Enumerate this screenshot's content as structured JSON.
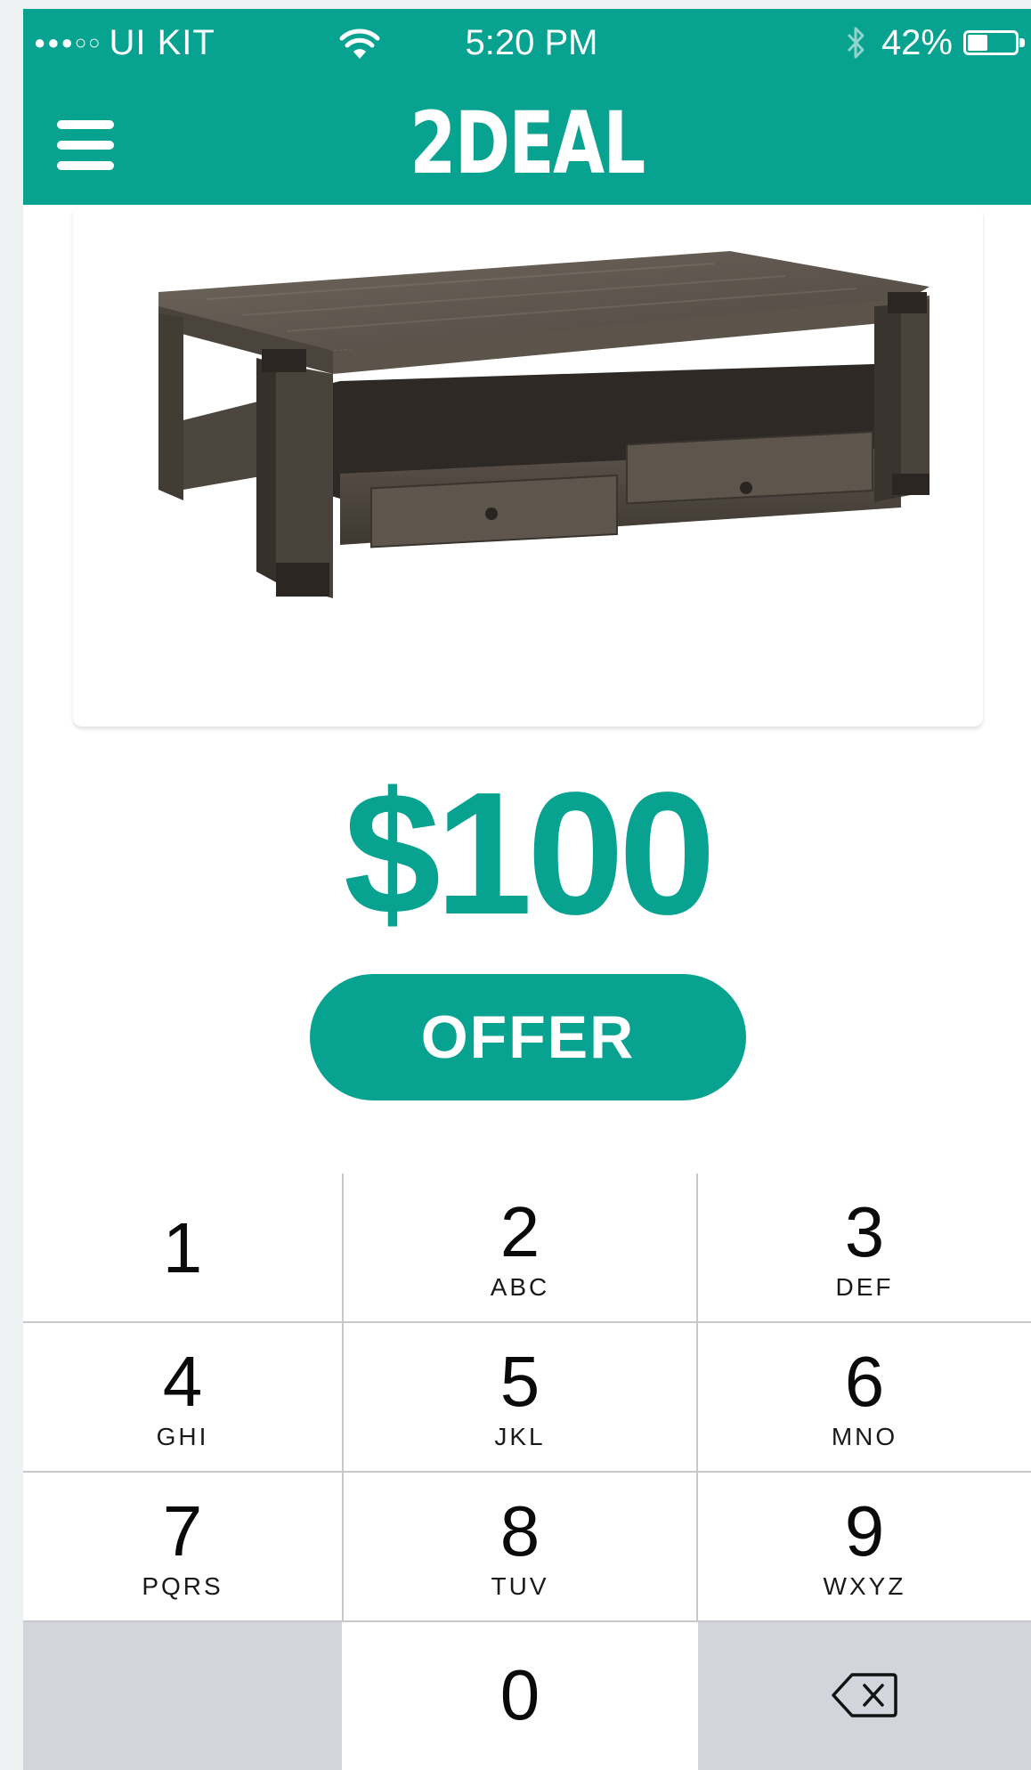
{
  "status_bar": {
    "carrier": "UI KIT",
    "signal_dots": "●●●○○",
    "time": "5:20 PM",
    "battery": "42%",
    "battery_level": 0.42
  },
  "nav": {
    "brand": "2DEAL"
  },
  "product": {
    "image_icon": "coffee-table-icon",
    "price": "$100"
  },
  "offer_button": {
    "label": "OFFER"
  },
  "keypad": {
    "keys": [
      {
        "digit": "1",
        "letters": ""
      },
      {
        "digit": "2",
        "letters": "ABC"
      },
      {
        "digit": "3",
        "letters": "DEF"
      },
      {
        "digit": "4",
        "letters": "GHI"
      },
      {
        "digit": "5",
        "letters": "JKL"
      },
      {
        "digit": "6",
        "letters": "MNO"
      },
      {
        "digit": "7",
        "letters": "PQRS"
      },
      {
        "digit": "8",
        "letters": "TUV"
      },
      {
        "digit": "9",
        "letters": "WXYZ"
      },
      {
        "digit": "0",
        "letters": ""
      }
    ],
    "delete_icon": "backspace-icon"
  },
  "colors": {
    "accent": "#08a291",
    "keypad_gray": "#d2d5db"
  }
}
